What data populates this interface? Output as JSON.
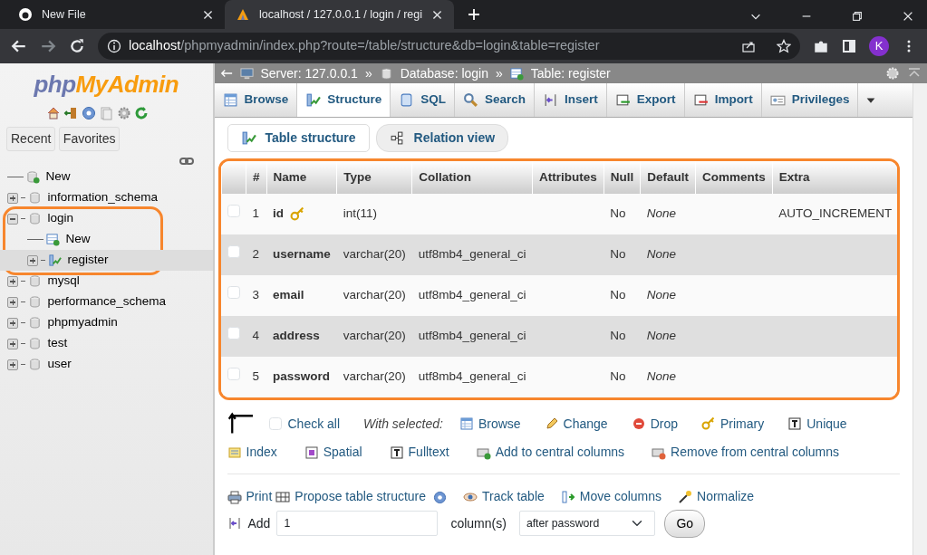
{
  "browser": {
    "tabs": [
      {
        "title": "New File",
        "selected": false
      },
      {
        "title": "localhost / 127.0.0.1 / login / regi",
        "selected": true
      }
    ],
    "url": {
      "host": "localhost",
      "path": "/phpmyadmin/index.php?route=/table/structure&db=login&table=register"
    },
    "profile": "K"
  },
  "sidebar": {
    "logo": {
      "part_1": "php",
      "part_2": "MyAdmin"
    },
    "buttons": [
      "Recent",
      "Favorites"
    ],
    "tree": [
      {
        "label": "New",
        "kind": "new",
        "selected": false
      },
      {
        "label": "information_schema",
        "kind": "db",
        "expanded": false,
        "selected": false
      },
      {
        "label": "login",
        "kind": "db",
        "expanded": true,
        "selected": false,
        "children": [
          {
            "label": "New",
            "kind": "newtable",
            "selected": false
          },
          {
            "label": "register",
            "kind": "table",
            "expanded": false,
            "selected": true
          }
        ]
      },
      {
        "label": "mysql",
        "kind": "db",
        "expanded": false,
        "selected": false
      },
      {
        "label": "performance_schema",
        "kind": "db",
        "expanded": false,
        "selected": false
      },
      {
        "label": "phpmyadmin",
        "kind": "db",
        "expanded": false,
        "selected": false
      },
      {
        "label": "test",
        "kind": "db",
        "expanded": false,
        "selected": false
      },
      {
        "label": "user",
        "kind": "db",
        "expanded": false,
        "selected": false
      }
    ]
  },
  "breadcrumb": [
    "Server: 127.0.0.1",
    "»",
    "Database: login",
    "»",
    "Table: register"
  ],
  "tabs": [
    {
      "label": "Browse",
      "selected": false
    },
    {
      "label": "Structure",
      "selected": true
    },
    {
      "label": "SQL",
      "selected": false
    },
    {
      "label": "Search",
      "selected": false
    },
    {
      "label": "Insert",
      "selected": false
    },
    {
      "label": "Export",
      "selected": false
    },
    {
      "label": "Import",
      "selected": false
    },
    {
      "label": "Privileges",
      "selected": false
    }
  ],
  "subtabs": [
    {
      "label": "Table structure",
      "selected": true
    },
    {
      "label": "Relation view",
      "selected": false
    }
  ],
  "table": {
    "columns": [
      "#",
      "Name",
      "Type",
      "Collation",
      "Attributes",
      "Null",
      "Default",
      "Comments",
      "Extra"
    ],
    "rows": [
      {
        "checked": false,
        "number": "1",
        "name": "id",
        "primary": true,
        "type": "int(11)",
        "collation": "",
        "null": "No",
        "default": "None",
        "extra": "AUTO_INCREMENT"
      },
      {
        "checked": false,
        "number": "2",
        "name": "username",
        "primary": false,
        "type": "varchar(20)",
        "collation": "utf8mb4_general_ci",
        "null": "No",
        "default": "None",
        "extra": ""
      },
      {
        "checked": false,
        "number": "3",
        "name": "email",
        "primary": false,
        "type": "varchar(20)",
        "collation": "utf8mb4_general_ci",
        "null": "No",
        "default": "None",
        "extra": ""
      },
      {
        "checked": false,
        "number": "4",
        "name": "address",
        "primary": false,
        "type": "varchar(20)",
        "collation": "utf8mb4_general_ci",
        "null": "No",
        "default": "None",
        "extra": ""
      },
      {
        "checked": false,
        "number": "5",
        "name": "password",
        "primary": false,
        "type": "varchar(20)",
        "collation": "utf8mb4_general_ci",
        "null": "No",
        "default": "None",
        "extra": ""
      }
    ]
  },
  "check_all": {
    "label": "Check all",
    "checked": false
  },
  "with_selected": "With selected:",
  "actions": [
    "Browse",
    "Change",
    "Drop",
    "Primary",
    "Unique",
    "Index",
    "Spatial",
    "Fulltext",
    "Add to central columns",
    "Remove from central columns"
  ],
  "links": [
    "Print",
    "Propose table structure",
    "Track table",
    "Move columns",
    "Normalize"
  ],
  "add_columns": {
    "label": "Add",
    "value": "1",
    "unit": "column(s)",
    "position": "after password",
    "button": "Go"
  }
}
